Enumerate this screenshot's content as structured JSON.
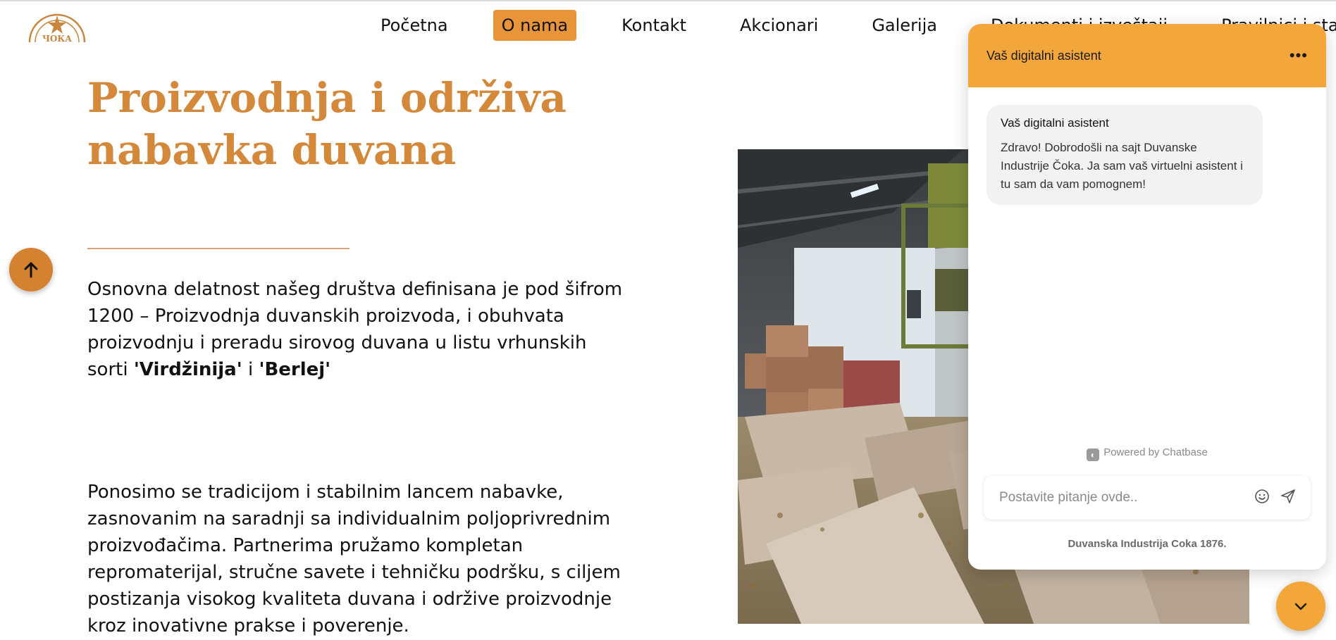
{
  "brand": {
    "logo_text": "ЧОКА",
    "logo_arc_text": "ДУВАНСКА ИНДУСТРИЈА"
  },
  "nav": {
    "items": [
      {
        "label": "Početna",
        "active": false
      },
      {
        "label": "O nama",
        "active": true
      },
      {
        "label": "Kontakt",
        "active": false
      },
      {
        "label": "Akcionari",
        "active": false
      },
      {
        "label": "Galerija",
        "active": false
      },
      {
        "label": "Dokumenti i izveštaji",
        "active": false
      },
      {
        "label": "Pravilnici i statuti",
        "active": false
      }
    ]
  },
  "hero": {
    "title_line1": "Proizvodnja i održiva",
    "title_line2": "nabavka duvana",
    "para1_text": "Osnovna delatnost našeg društva definisana je pod šifrom 1200 – Proizvodnja duvanskih proizvoda, i obuhvata proizvodnju i preradu sirovog duvana u listu vrhunskih sorti ",
    "para1_q1_open": "'",
    "para1_bold1": "Virdžinija",
    "para1_q1_close": "'",
    "para1_and": " i ",
    "para1_q2_open": "'",
    "para1_bold2": "Berlej",
    "para1_q2_close": "'",
    "para2_text": "Ponosimo se tradicijom i stabilnim lancem nabavke, zasnovanim na saradnji sa individualnim poljoprivrednim proizvođačima. Partnerima pružamo kompletan repromaterijal, stručne savete i tehničku podršku, s ciljem postizanja visokog kvaliteta duvana i održive proizvodnje kroz inovativne prakse i poverenje."
  },
  "colors": {
    "accent": "#e8953a",
    "heading": "#d4883a",
    "chat_header": "#f3a63a"
  },
  "chat": {
    "header_title": "Vaš digitalni asistent",
    "menu_label": "•••",
    "message_sender": "Vaš digitalni asistent",
    "message_text": "Zdravo! Dobrodošli na sajt Duvanske Industrije Čoka. Ja sam vaš virtuelni asistent i tu sam da vam pomognem!",
    "powered_by": "Powered by Chatbase",
    "input_placeholder": "Postavite pitanje ovde..",
    "footer": "Duvanska Industrija Coka 1876."
  },
  "icons": {
    "scroll_up": "arrow-up-icon",
    "chat_toggle": "chevron-down-icon",
    "emoji": "smile-icon",
    "send": "send-icon"
  }
}
